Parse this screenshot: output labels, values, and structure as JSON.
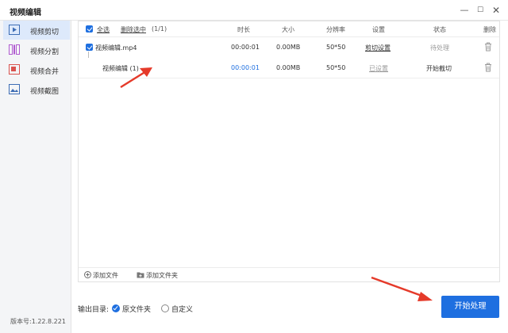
{
  "window": {
    "title": "视频编辑",
    "min_glyph": "—",
    "max_glyph": "☐",
    "close_glyph": "✕"
  },
  "sidebar": {
    "items": [
      {
        "label": "视频剪切",
        "icon": "video-cut-icon",
        "active": true
      },
      {
        "label": "视频分割",
        "icon": "video-split-icon",
        "active": false
      },
      {
        "label": "视频合并",
        "icon": "video-merge-icon",
        "active": false
      },
      {
        "label": "视频截图",
        "icon": "video-screenshot-icon",
        "active": false
      }
    ],
    "version": "版本号:1.22.8.221"
  },
  "table": {
    "select_all": "全选",
    "delete_selected": "删除选中",
    "count": "(1/1)",
    "columns": {
      "duration": "时长",
      "size": "大小",
      "resolution": "分辨率",
      "settings": "设置",
      "status": "状态",
      "delete": "删除"
    },
    "rows": [
      {
        "name": "视频编辑.mp4",
        "duration": "00:00:01",
        "size": "0.00MB",
        "resolution": "50*50",
        "settings": "剪切设置",
        "status": "待处理"
      },
      {
        "name": "视频编辑 (1)",
        "duration": "00:00:01",
        "size": "0.00MB",
        "resolution": "50*50",
        "settings": "已设置",
        "status": "开始截切"
      }
    ]
  },
  "footer": {
    "add_file": "添加文件",
    "add_folder": "添加文件夹"
  },
  "output": {
    "label": "输出目录:",
    "option_original": "原文件夹",
    "option_custom": "自定义",
    "selected": "原文件夹"
  },
  "start_button": "开始处理",
  "colors": {
    "accent": "#1e6fe0",
    "annotation_arrow": "#e53a2a",
    "sidebar_bg": "#f4f5f7",
    "active_item_bg": "#dde9fb"
  }
}
